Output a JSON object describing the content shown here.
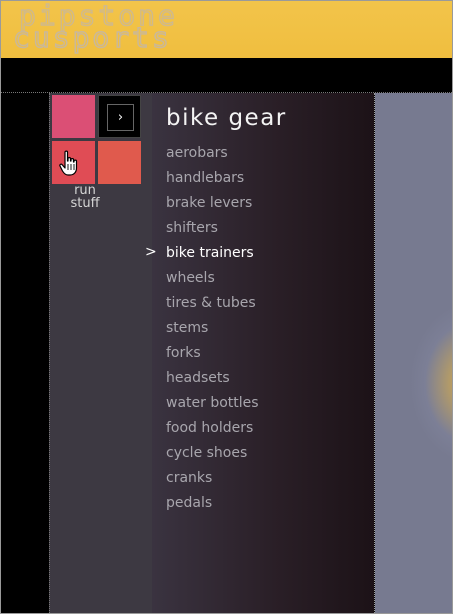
{
  "header": {
    "logo_line1": "pipstone",
    "logo_line2": "cusports"
  },
  "sidebar": {
    "run_label_line1": "run",
    "run_label_line2": "stuff",
    "arrow_glyph": "›"
  },
  "menu": {
    "title": "bike gear",
    "selected_marker": ">",
    "items": [
      {
        "label": "aerobars"
      },
      {
        "label": "handlebars"
      },
      {
        "label": "brake levers"
      },
      {
        "label": "shifters"
      },
      {
        "label": "bike trainers"
      },
      {
        "label": "wheels"
      },
      {
        "label": "tires & tubes"
      },
      {
        "label": "stems"
      },
      {
        "label": "forks"
      },
      {
        "label": "headsets"
      },
      {
        "label": "water bottles"
      },
      {
        "label": "food holders"
      },
      {
        "label": "cycle shoes"
      },
      {
        "label": "cranks"
      },
      {
        "label": "pedals"
      }
    ],
    "selected_index": 4
  },
  "colors": {
    "header": "#f0be3f",
    "tile_pink": "#db4f75",
    "tile_red": "#e04c55",
    "tile_orange": "#e05a4d",
    "menu_text": "#a8a6ad",
    "selected_text": "#ffffff"
  },
  "icons": {
    "cursor": "hand-pointer-icon",
    "arrow": "chevron-right-icon"
  }
}
